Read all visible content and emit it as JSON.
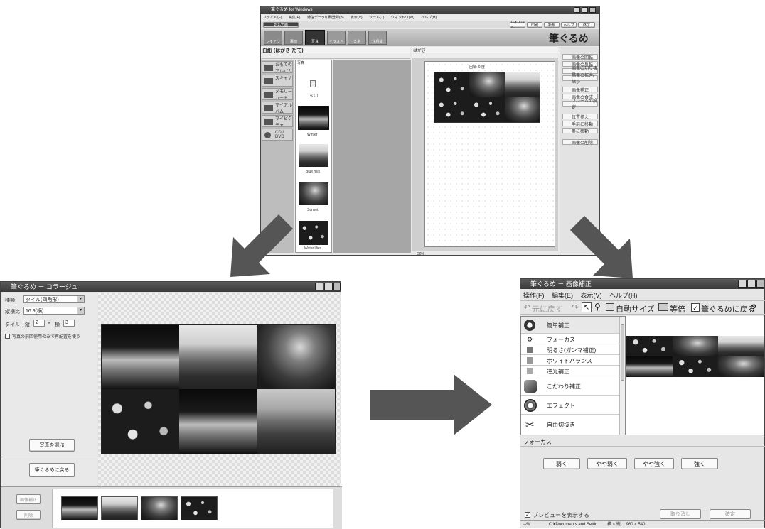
{
  "top_window": {
    "title": "筆ぐるめ for Windows",
    "menu": [
      "ファイル(F)",
      "編集(E)",
      "通信データ印刷登録(B)",
      "表示(V)",
      "ツール(T)",
      "ウィンドウ(W)",
      "ヘルプ(H)"
    ],
    "toolbar_left_label": "おもて面",
    "toolbar_tabs": [
      "レイアウト",
      "裏面",
      "写真",
      "イラスト",
      "文字",
      "住所録"
    ],
    "toolbar_right": [
      "レイアウト",
      "印刷",
      "新規",
      "ヘルプ",
      "終了"
    ],
    "logo": "筆ぐるめ",
    "doc_title": "白紙 (はがき たて)",
    "tree_items": [
      "おもてのアルバム",
      "スキャナー",
      "メモリーカード",
      "マイアルバム",
      "マイピクチャ",
      "CD / DVD"
    ],
    "list_header": "写真",
    "list_items": [
      "(なし)",
      "Winter",
      "Blue hills",
      "Sunset",
      "Water lilies"
    ],
    "canvas_header": "はがき",
    "canvas_caption": "回転: 0 度",
    "zoom": "50%",
    "right_buttons": [
      "画像の回転",
      "画像の反転",
      "画像の切り抜き",
      "画像の拡大/縮小",
      "画像補正",
      "画像の合成",
      "フレームの設定",
      "位置揃え",
      "手前に移動",
      "奥に移動",
      "画像の削除"
    ]
  },
  "collage_window": {
    "title": "筆ぐるめ － コラージュ",
    "type_label": "種類",
    "type_value": "タイル(四角形)",
    "ratio_label": "縦横比",
    "ratio_value": "16:9(横)",
    "tile_label": "タイル",
    "tile_rows_label": "縦",
    "tile_rows_value": "2",
    "tile_cols_label": "横",
    "tile_cols_value": "3",
    "times": "×",
    "checkbox_label": "写真の前回使用のみで再配置を使う",
    "choose_photo_button": "写真を選ぶ",
    "back_button": "筆ぐるめに戻る",
    "bottom_buttons": [
      "画像補正",
      "削除"
    ]
  },
  "correction_window": {
    "title": "筆ぐるめ － 画像補正",
    "menu": [
      "操作(F)",
      "編集(E)",
      "表示(V)",
      "ヘルプ(H)"
    ],
    "toolbar": {
      "undo": "元に戻す",
      "auto_size": "自動サイズ",
      "same_size": "等倍",
      "back": "筆ぐるめに戻る",
      "help": "?"
    },
    "menu_items": [
      "簡単補正",
      "フォーカス",
      "明るさ(ガンマ補正)",
      "ホワイトバランス",
      "逆光補正",
      "こだわり補正",
      "エフェクト",
      "自由切抜き"
    ],
    "section_label": "フォーカス",
    "focus_buttons": [
      "弱く",
      "やや弱く",
      "やや強く",
      "強く"
    ],
    "preview_checkbox": "プレビューを表示する",
    "ok_button": "取り消し",
    "confirm_button": "確定",
    "status_left": "--%",
    "status_path": "C:¥Documents and Settin",
    "status_size": "横 × 縦： 960 × 540"
  },
  "colors": {
    "arrow": "#555555",
    "titlebar": "#3a3a3a",
    "window_bg": "#e9e9e9"
  }
}
